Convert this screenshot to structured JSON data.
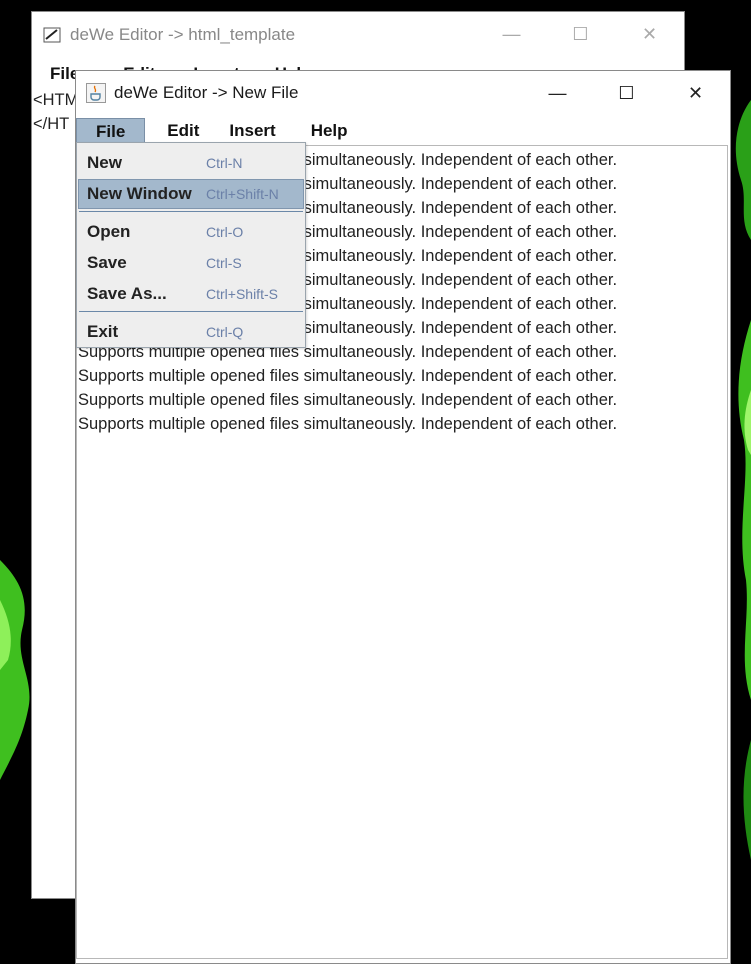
{
  "back_window": {
    "title": "deWe Editor -> html_template",
    "menu": [
      "File",
      "Edit",
      "Insert",
      "Help"
    ],
    "lines": [
      "<HTM",
      "",
      "",
      "",
      "</HT"
    ]
  },
  "front_window": {
    "title": "deWe Editor -> New File",
    "menu": [
      "File",
      "Edit",
      "Insert",
      "Help"
    ],
    "window_controls": {
      "minimize": "—",
      "maximize": "☐",
      "close": "✕"
    },
    "lines": [
      "Supports multiple opened files simultaneously. Independent of each other.",
      "Supports multiple opened files simultaneously. Independent of each other.",
      "Supports multiple opened files simultaneously. Independent of each other.",
      "Supports multiple opened files simultaneously. Independent of each other.",
      "Supports multiple opened files simultaneously. Independent of each other.",
      "Supports multiple opened files simultaneously. Independent of each other.",
      "Supports multiple opened files simultaneously. Independent of each other.",
      "Supports multiple opened files simultaneously. Independent of each other.",
      "Supports multiple opened files simultaneously. Independent of each other.",
      "Supports multiple opened files simultaneously. Independent of each other.",
      "Supports multiple opened files simultaneously. Independent of each other.",
      "Supports multiple opened files simultaneously. Independent of each other."
    ]
  },
  "file_menu": {
    "items": [
      {
        "label": "New",
        "shortcut": "Ctrl-N"
      },
      {
        "label": "New Window",
        "shortcut": "Ctrl+Shift-N",
        "highlighted": true
      },
      {
        "label": "Open",
        "shortcut": "Ctrl-O"
      },
      {
        "label": "Save",
        "shortcut": "Ctrl-S"
      },
      {
        "label": "Save As...",
        "shortcut": "Ctrl+Shift-S"
      },
      {
        "label": "Exit",
        "shortcut": "Ctrl-Q"
      }
    ]
  },
  "colors": {
    "menu_highlight": "#a3b8cc",
    "shortcut_text": "#6b80a8",
    "separator": "#6b88a8"
  },
  "icons": {
    "back_app_icon": "pen-icon",
    "front_app_icon": "java-cup-icon"
  }
}
